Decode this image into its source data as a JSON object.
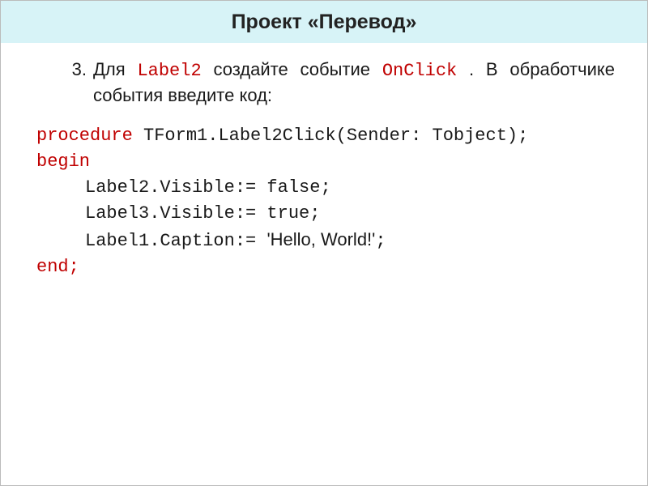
{
  "title": "Проект «Перевод»",
  "instruction": {
    "marker": "3.",
    "parts": [
      "Для ",
      "Label2",
      " создайте событие ",
      "OnClick",
      ". В обработчике события введите код:"
    ]
  },
  "code": {
    "line1": {
      "kw": "procedure",
      "rest": " TForm1.Label2Click(Sender: Tobject);"
    },
    "line2": "begin",
    "line3": "Label2.Visible:= false;",
    "line4": "Label3.Visible:= true;",
    "line5": {
      "a": "Label1.Caption:= ",
      "b": "'Hello, World!'",
      "c": ";"
    },
    "line6": "end;"
  }
}
